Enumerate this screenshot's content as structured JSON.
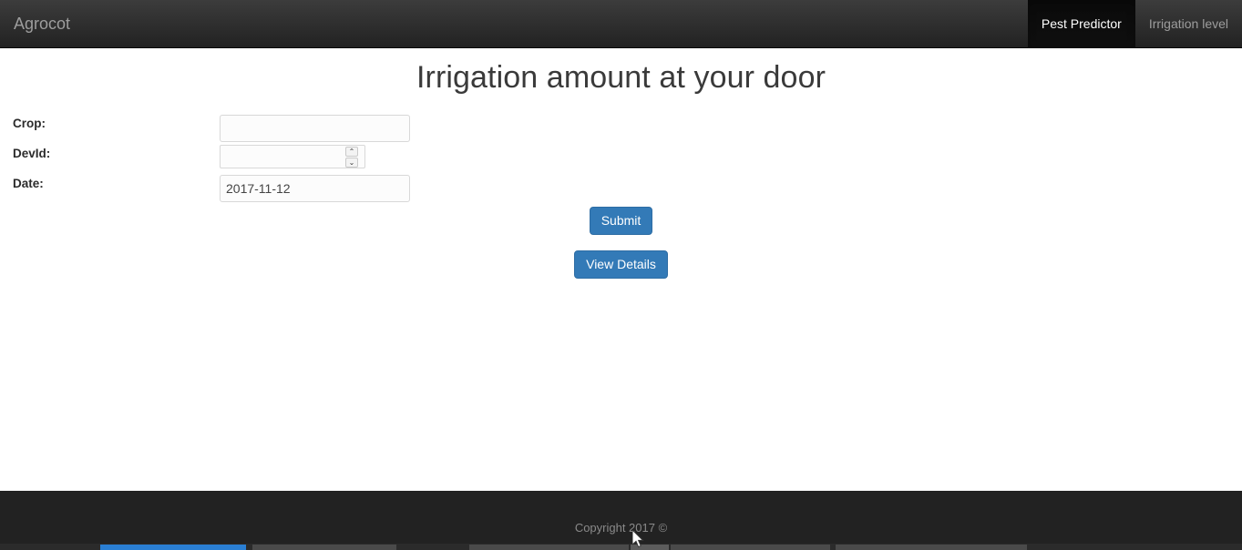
{
  "navbar": {
    "brand": "Agrocot",
    "items": [
      {
        "label": "Pest Predictor",
        "active": true
      },
      {
        "label": "Irrigation level",
        "active": false
      }
    ]
  },
  "main": {
    "title": "Irrigation amount at your door",
    "fields": [
      {
        "label": "Crop:",
        "value": "",
        "type": "text"
      },
      {
        "label": "DevId:",
        "value": "",
        "type": "number"
      },
      {
        "label": "Date:",
        "value": "2017-11-12",
        "type": "text"
      }
    ],
    "spinner": {
      "up": "⌃",
      "down": "⌄"
    },
    "submit_label": "Submit",
    "details_label": "View Details"
  },
  "footer": {
    "copyright": "Copyright 2017 ©"
  },
  "colors": {
    "navbar_bg": "#222222",
    "navbar_active_bg": "#080808",
    "navbar_text": "#9d9d9d",
    "primary": "#337ab7",
    "primary_border": "#2e6da4",
    "title_text": "#3a3a3a",
    "taskbar_active": "#2a7fd4"
  }
}
